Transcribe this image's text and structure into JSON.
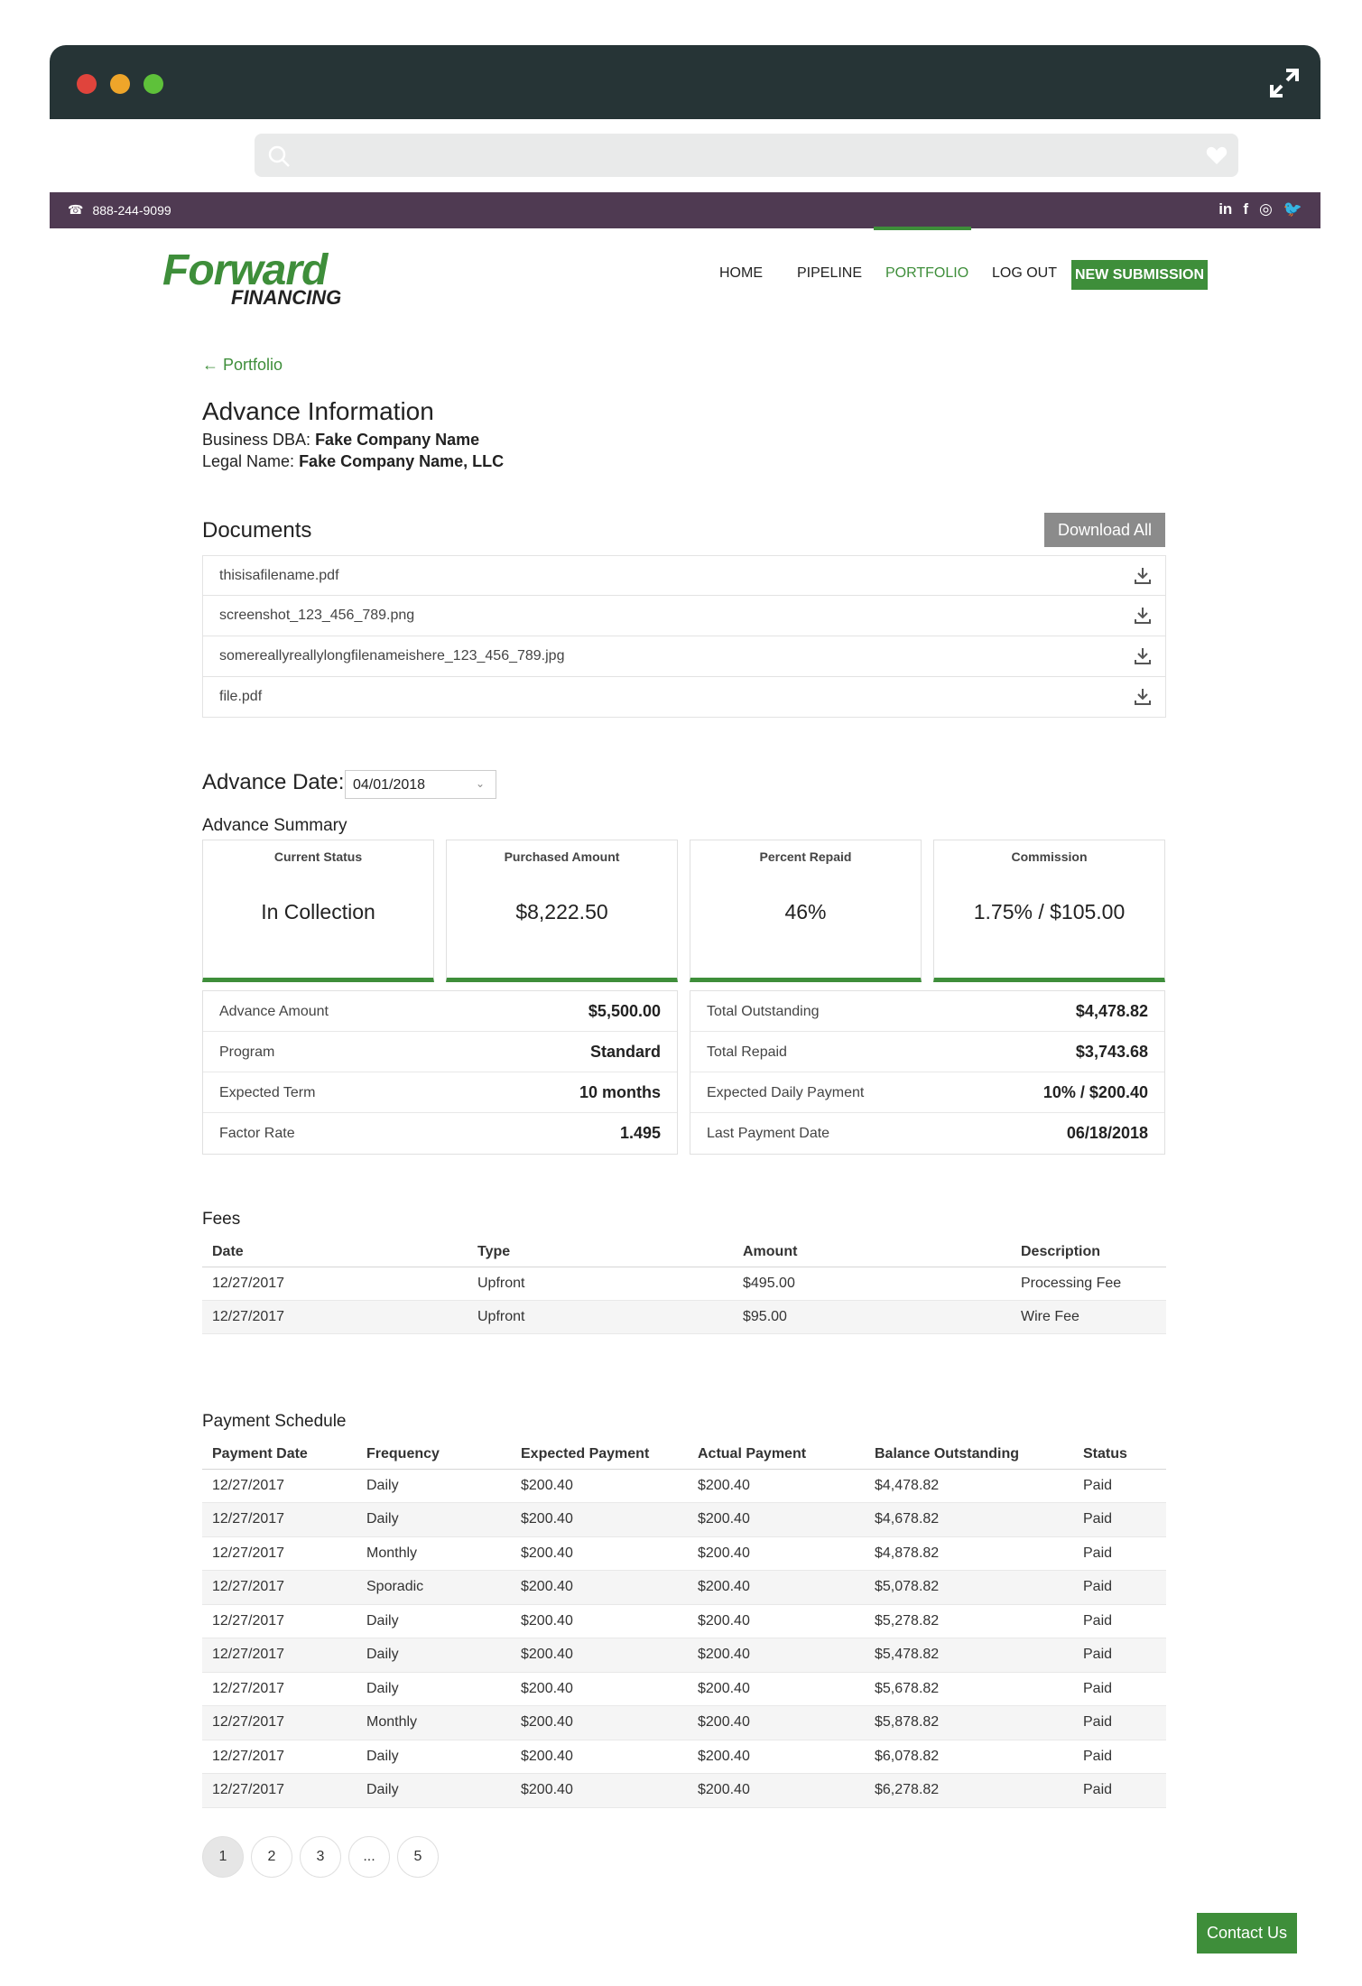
{
  "topbar": {
    "phone": "888-244-9099",
    "socials": [
      "in",
      "f",
      "◎",
      "🐦"
    ]
  },
  "logo": {
    "word1": "Forward",
    "word2": "FINANCING"
  },
  "nav": {
    "items": [
      {
        "label": "HOME"
      },
      {
        "label": "PIPELINE"
      },
      {
        "label": "PORTFOLIO"
      },
      {
        "label": "LOG OUT"
      }
    ],
    "active": "PORTFOLIO",
    "cta": "NEW SUBMISSION"
  },
  "breadcrumb": {
    "back": "← Portfolio"
  },
  "advance": {
    "title": "Advance Information",
    "dba_label": "Business DBA: ",
    "dba_value": "Fake Company Name",
    "legal_label": "Legal Name: ",
    "legal_value": "Fake Company Name, LLC"
  },
  "documents": {
    "title": "Documents",
    "download_all": "Download All",
    "files": [
      "thisisafilename.pdf",
      "screenshot_123_456_789.png",
      "somereallyreallylongfilenameishere_123_456_789.jpg",
      "file.pdf"
    ]
  },
  "advance_date": {
    "label": "Advance Date:",
    "value": "04/01/2018"
  },
  "summary": {
    "title": "Advance Summary",
    "cards": [
      {
        "label": "Current Status",
        "value": "In Collection"
      },
      {
        "label": "Purchased Amount",
        "value": "$8,222.50"
      },
      {
        "label": "Percent Repaid",
        "value": "46%"
      },
      {
        "label": "Commission",
        "value": "1.75% / $105.00"
      }
    ],
    "left": [
      {
        "k": "Advance Amount",
        "v": "$5,500.00"
      },
      {
        "k": "Program",
        "v": "Standard"
      },
      {
        "k": "Expected Term",
        "v": "10 months"
      },
      {
        "k": "Factor Rate",
        "v": "1.495"
      }
    ],
    "right": [
      {
        "k": "Total Outstanding",
        "v": "$4,478.82"
      },
      {
        "k": "Total Repaid",
        "v": "$3,743.68"
      },
      {
        "k": "Expected Daily Payment",
        "v": "10% / $200.40"
      },
      {
        "k": "Last Payment Date",
        "v": "06/18/2018"
      }
    ]
  },
  "fees": {
    "title": "Fees",
    "headers": [
      "Date",
      "Type",
      "Amount",
      "Description"
    ],
    "rows": [
      [
        "12/27/2017",
        "Upfront",
        "$495.00",
        "Processing Fee"
      ],
      [
        "12/27/2017",
        "Upfront",
        "$95.00",
        "Wire Fee"
      ]
    ]
  },
  "payments": {
    "title": "Payment Schedule",
    "headers": [
      "Payment Date",
      "Frequency",
      "Expected Payment",
      "Actual Payment",
      "Balance Outstanding",
      "Status"
    ],
    "rows": [
      [
        "12/27/2017",
        "Daily",
        "$200.40",
        "$200.40",
        "$4,478.82",
        "Paid"
      ],
      [
        "12/27/2017",
        "Daily",
        "$200.40",
        "$200.40",
        "$4,678.82",
        "Paid"
      ],
      [
        "12/27/2017",
        "Monthly",
        "$200.40",
        "$200.40",
        "$4,878.82",
        "Paid"
      ],
      [
        "12/27/2017",
        "Sporadic",
        "$200.40",
        "$200.40",
        "$5,078.82",
        "Paid"
      ],
      [
        "12/27/2017",
        "Daily",
        "$200.40",
        "$200.40",
        "$5,278.82",
        "Paid"
      ],
      [
        "12/27/2017",
        "Daily",
        "$200.40",
        "$200.40",
        "$5,478.82",
        "Paid"
      ],
      [
        "12/27/2017",
        "Daily",
        "$200.40",
        "$200.40",
        "$5,678.82",
        "Paid"
      ],
      [
        "12/27/2017",
        "Monthly",
        "$200.40",
        "$200.40",
        "$5,878.82",
        "Paid"
      ],
      [
        "12/27/2017",
        "Daily",
        "$200.40",
        "$200.40",
        "$6,078.82",
        "Paid"
      ],
      [
        "12/27/2017",
        "Daily",
        "$200.40",
        "$200.40",
        "$6,278.82",
        "Paid"
      ]
    ]
  },
  "pagination": {
    "pages": [
      "1",
      "2",
      "3",
      "...",
      "5"
    ],
    "current": "1"
  },
  "contact": "Contact Us",
  "colors": {
    "brand_green": "#3e8e3a",
    "strip_purple": "#4f3a52",
    "chrome_dark": "#263436"
  }
}
